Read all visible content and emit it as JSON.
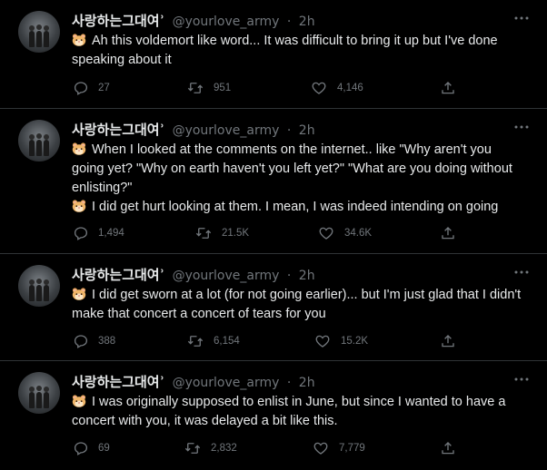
{
  "icons": {
    "avatar": "profile-photo",
    "more": "more-horizontal-icon",
    "reply": "reply-icon",
    "retweet": "retweet-icon",
    "like": "heart-icon",
    "share": "share-icon",
    "emoji": "hamster-face-emoji"
  },
  "colors": {
    "background": "#000000",
    "text": "#e7e9ea",
    "secondary": "#71767b",
    "divider": "#2f3336"
  },
  "tweets": [
    {
      "name": "사랑하는그대여ʾ",
      "handle": "@yourlove_army",
      "dot": "·",
      "time": "2h",
      "lines": [
        "Ah this voldemort like word... It was difficult to bring it up but I've done speaking about it"
      ],
      "replies": "27",
      "retweets": "951",
      "likes": "4,146"
    },
    {
      "name": "사랑하는그대여ʾ",
      "handle": "@yourlove_army",
      "dot": "·",
      "time": "2h",
      "lines": [
        "When I looked at the comments on the internet.. like \"Why aren't you going yet? \"Why on earth haven't you left yet?\" \"What are you doing without enlisting?\"",
        "I did get hurt looking at them. I mean, I was indeed intending on going"
      ],
      "replies": "1,494",
      "retweets": "21.5K",
      "likes": "34.6K"
    },
    {
      "name": "사랑하는그대여ʾ",
      "handle": "@yourlove_army",
      "dot": "·",
      "time": "2h",
      "lines": [
        "I did get sworn at a lot (for not going earlier)... but I'm just glad that I didn't make that concert a concert of tears for you"
      ],
      "replies": "388",
      "retweets": "6,154",
      "likes": "15.2K"
    },
    {
      "name": "사랑하는그대여ʾ",
      "handle": "@yourlove_army",
      "dot": "·",
      "time": "2h",
      "lines": [
        "I was originally supposed to enlist in June, but since I wanted to have a concert with you, it was delayed a bit like this."
      ],
      "replies": "69",
      "retweets": "2,832",
      "likes": "7,779"
    }
  ]
}
